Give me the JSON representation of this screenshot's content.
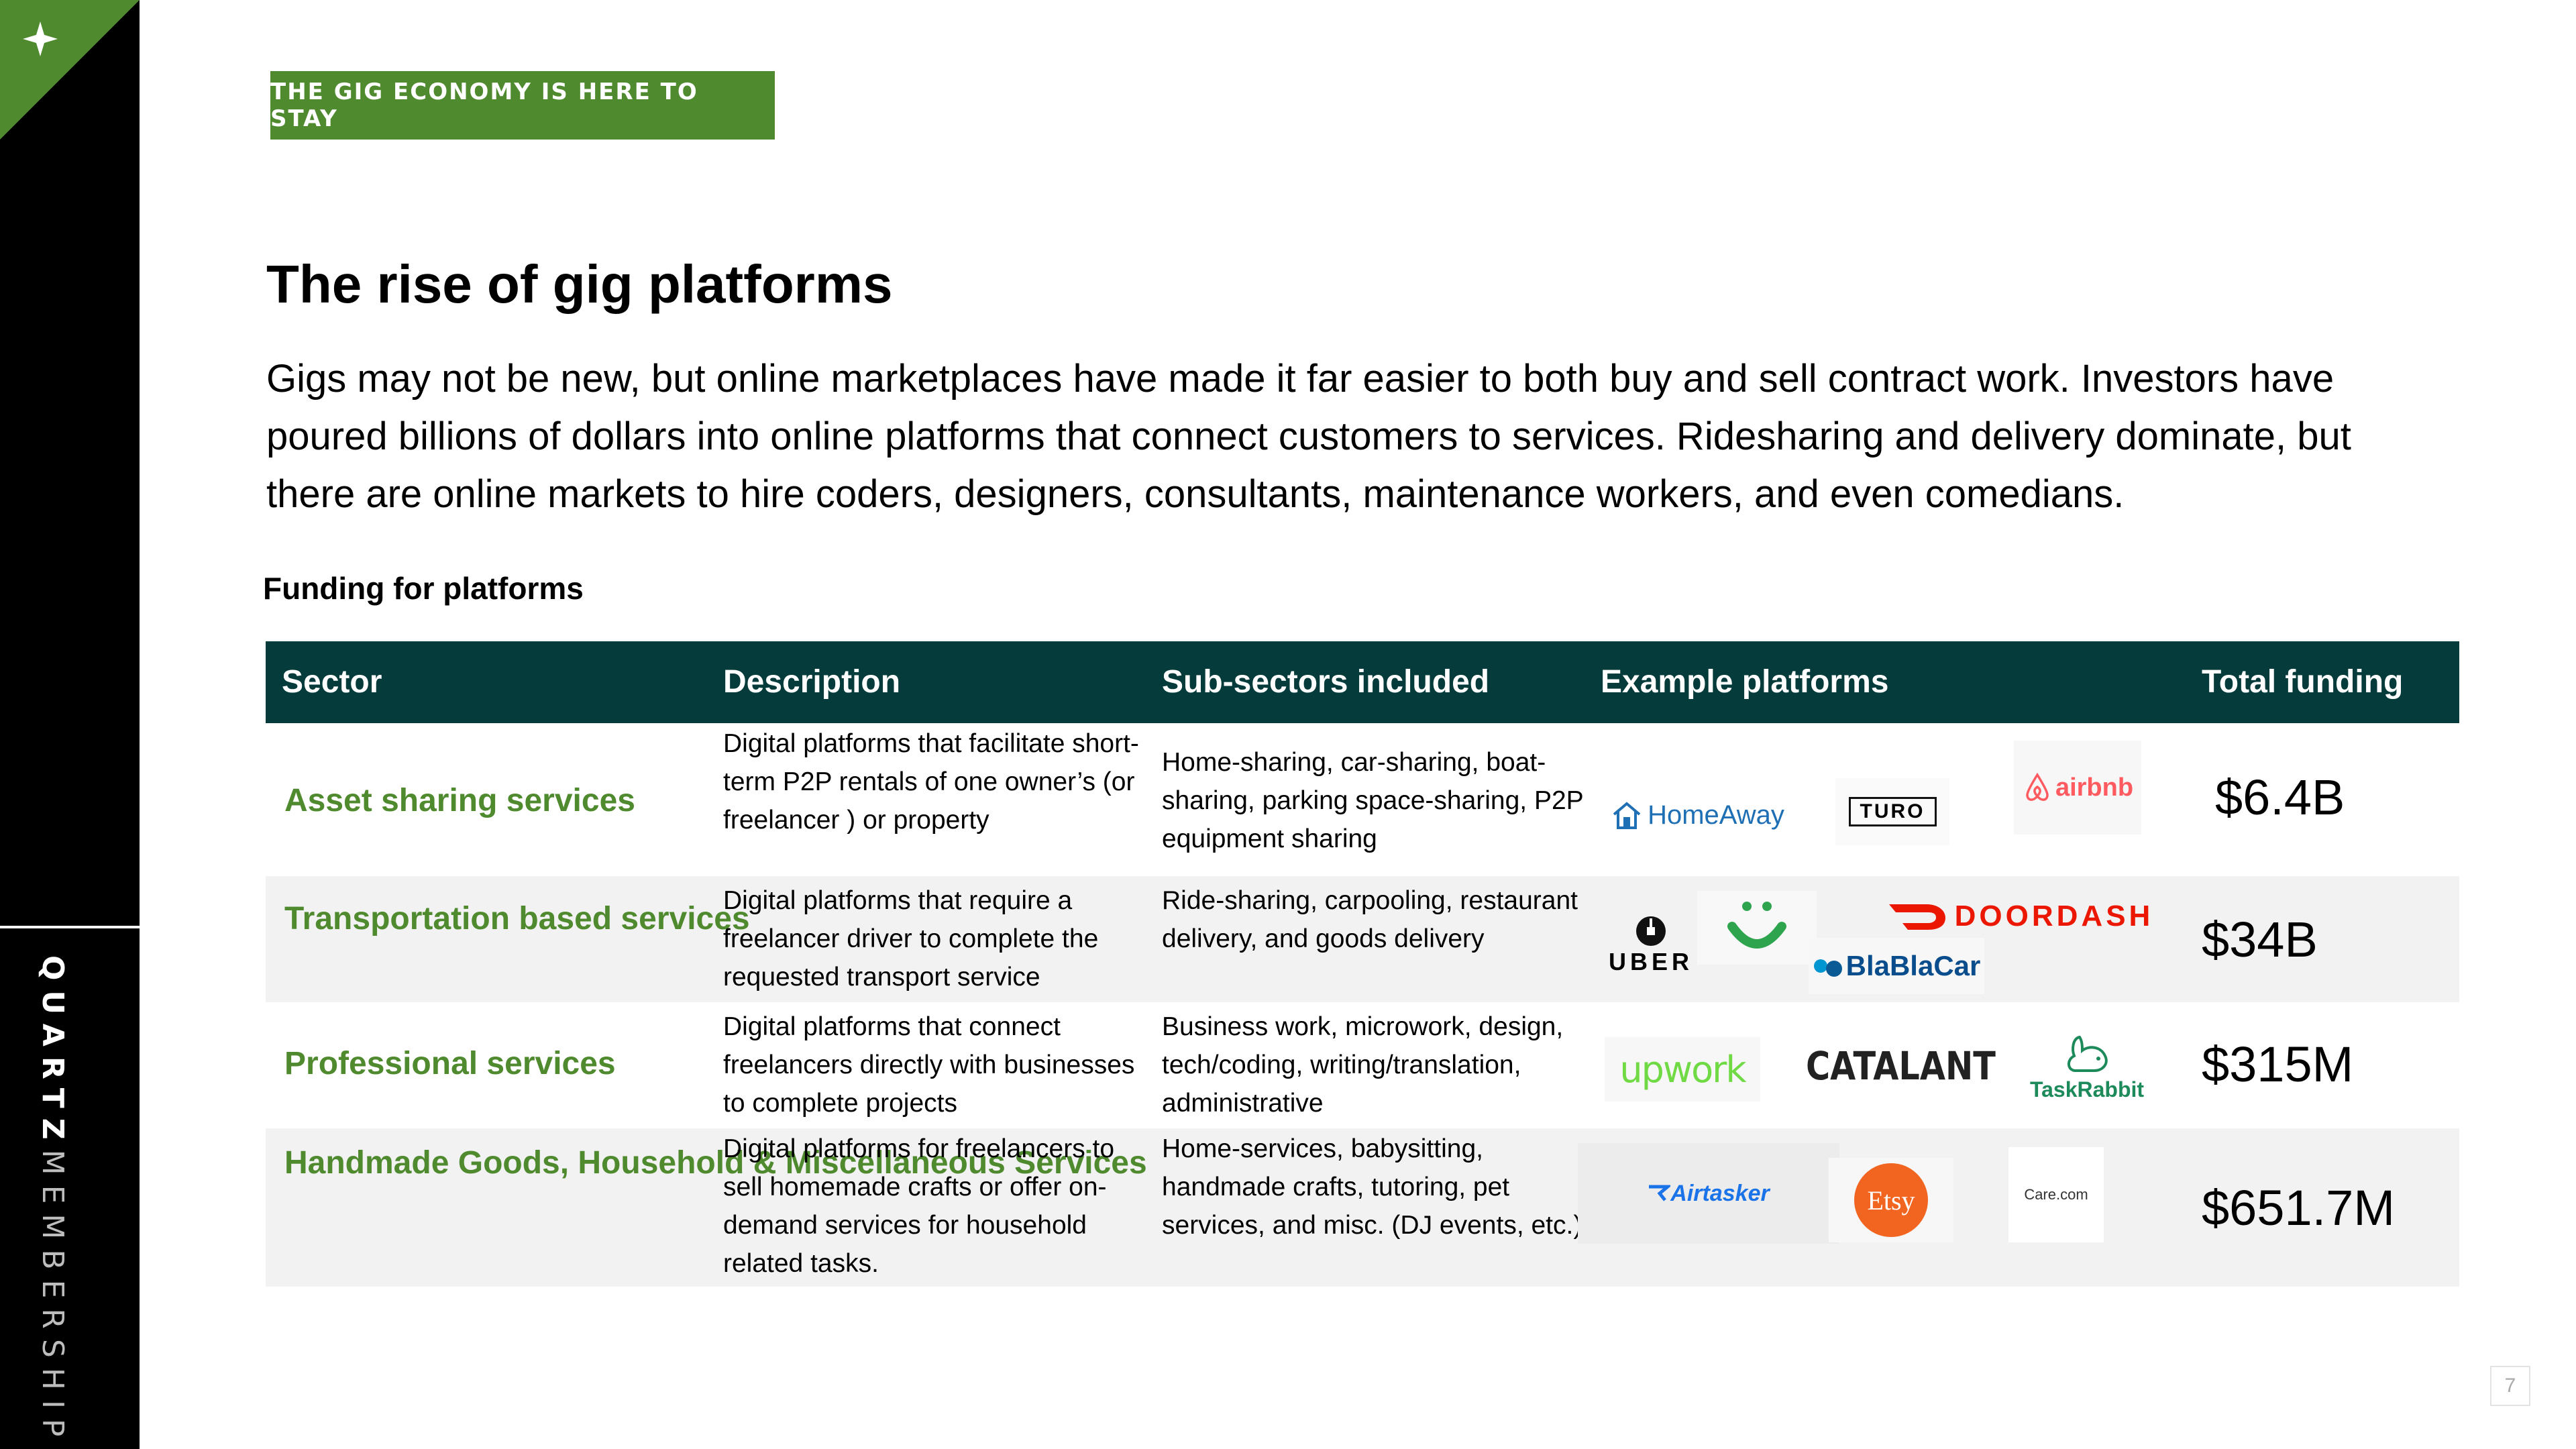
{
  "brand": {
    "name_bold": "QUARTZ",
    "name_light": "MEMBERSHIP"
  },
  "tag": "THE GIG ECONOMY IS HERE TO STAY",
  "title": "The rise of gig platforms",
  "intro": "Gigs may not be new, but online marketplaces have made it far easier to both buy and sell contract work. Investors have poured billions of dollars into online platforms that connect customers to services. Ridesharing and delivery dominate, but there are online markets to hire coders, designers, consultants, maintenance workers, and even comedians.",
  "table_caption": "Funding for platforms",
  "table": {
    "headers": [
      "Sector",
      "Description",
      "Sub-sectors included",
      "Example platforms",
      "Total funding"
    ],
    "rows": [
      {
        "sector": "Asset sharing services",
        "description": "Digital platforms that facilitate short-term P2P rentals of one owner’s (or freelancer ) or property",
        "subsectors": "Home-sharing, car-sharing, boat-sharing, parking space-sharing, P2P equipment sharing",
        "platforms": [
          "HomeAway",
          "TURO",
          "airbnb"
        ],
        "funding": "$6.4B"
      },
      {
        "sector": "Transportation based services",
        "description": "Digital platforms that require a freelancer driver to complete the requested transport service",
        "subsectors": "Ride-sharing, carpooling, restaurant delivery, and goods delivery",
        "platforms": [
          "UBER",
          "Instacart",
          "DOORDASH",
          "BlaBlaCar"
        ],
        "funding": "$34B"
      },
      {
        "sector": "Professional services",
        "description": "Digital platforms that connect freelancers directly with businesses to complete projects",
        "subsectors": "Business work, microwork, design, tech/coding, writing/translation, administrative",
        "platforms": [
          "upwork",
          "CATALANT",
          "TaskRabbit"
        ],
        "funding": "$315M"
      },
      {
        "sector": "Handmade Goods, Household & Miscellaneous Services",
        "description": "Digital platforms for freelancers to sell homemade crafts or offer on-demand services for household related tasks.",
        "subsectors": "Home-services, babysitting, handmade crafts, tutoring, pet services, and misc. (DJ events, etc.)",
        "platforms": [
          "Airtasker",
          "Etsy",
          "Care.com"
        ],
        "funding": "$651.7M"
      }
    ]
  },
  "page_number": "7",
  "colors": {
    "accent_green": "#4f8a2e",
    "header_teal": "#063b3b",
    "row_alt": "#f2f2f2",
    "sidebar": "#000000"
  }
}
